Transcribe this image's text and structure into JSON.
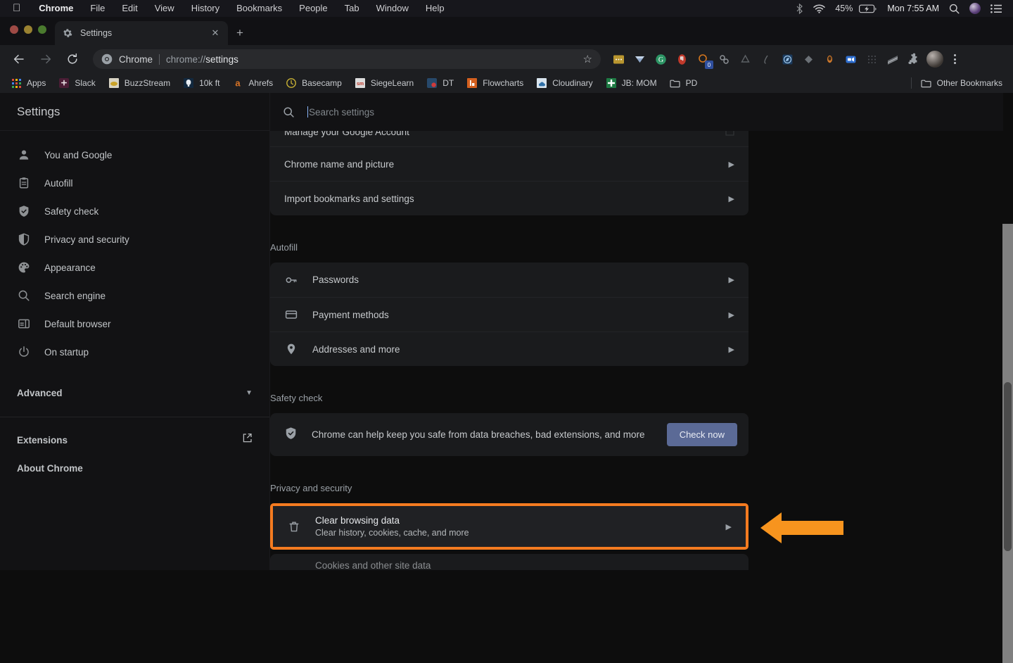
{
  "menubar": {
    "apple_icon": "apple-logo",
    "items": [
      {
        "label": "Chrome",
        "bold": true
      },
      {
        "label": "File",
        "bold": false
      },
      {
        "label": "Edit",
        "bold": false
      },
      {
        "label": "View",
        "bold": false
      },
      {
        "label": "History",
        "bold": false
      },
      {
        "label": "Bookmarks",
        "bold": false
      },
      {
        "label": "People",
        "bold": false
      },
      {
        "label": "Tab",
        "bold": false
      },
      {
        "label": "Window",
        "bold": false
      },
      {
        "label": "Help",
        "bold": false
      }
    ],
    "status": {
      "bluetooth_icon": "bluetooth-icon",
      "wifi_icon": "wifi-icon",
      "battery_percent": "45%",
      "battery_icon": "battery-charging-icon",
      "clock": "Mon 7:55 AM",
      "search_icon": "search-icon",
      "control_center_icon": "control-center-icon",
      "list_icon": "list-icon"
    }
  },
  "tabstrip": {
    "tab": {
      "title": "Settings",
      "favicon": "gear-icon",
      "close_icon": "close-icon"
    },
    "new_tab_label": "+"
  },
  "toolbar": {
    "back_icon": "back-arrow-icon",
    "forward_icon": "forward-arrow-icon",
    "reload_icon": "reload-icon",
    "omnibox": {
      "favicon": "chrome-icon",
      "label": "Chrome",
      "url_prefix": "chrome://",
      "url_bold": "settings",
      "bookmark_star_icon": "star-icon"
    },
    "extensions": [
      {
        "name": "extension-yellow-dots",
        "badge": ""
      },
      {
        "name": "extension-diamond",
        "badge": ""
      },
      {
        "name": "extension-grammarly",
        "badge": ""
      },
      {
        "name": "extension-opera-red",
        "badge": ""
      },
      {
        "name": "extension-orange-ring",
        "badge": "0"
      },
      {
        "name": "extension-link-chain",
        "badge": ""
      },
      {
        "name": "extension-recycle",
        "badge": ""
      },
      {
        "name": "extension-pen",
        "badge": ""
      },
      {
        "name": "extension-compass-blue",
        "badge": ""
      },
      {
        "name": "extension-diamond-gray",
        "badge": ""
      },
      {
        "name": "extension-person-orange",
        "badge": ""
      },
      {
        "name": "extension-video-blue",
        "badge": ""
      },
      {
        "name": "extension-grid-dots",
        "badge": ""
      },
      {
        "name": "extension-stripes",
        "badge": ""
      },
      {
        "name": "extension-puzzle",
        "badge": ""
      }
    ],
    "profile_avatar": "avatar",
    "menu_icon": "kebab-menu-icon"
  },
  "bookmarks_bar": {
    "items": [
      {
        "label": "Apps",
        "icon": "apps-grid-icon"
      },
      {
        "label": "Slack",
        "icon": "slack-icon"
      },
      {
        "label": "BuzzStream",
        "icon": "buzzstream-icon"
      },
      {
        "label": "10k ft",
        "icon": "balloon-icon"
      },
      {
        "label": "Ahrefs",
        "icon": "ahrefs-icon"
      },
      {
        "label": "Basecamp",
        "icon": "basecamp-icon"
      },
      {
        "label": "SiegeLearn",
        "icon": "siegelearn-icon"
      },
      {
        "label": "DT",
        "icon": "dt-icon"
      },
      {
        "label": "Flowcharts",
        "icon": "flowcharts-icon"
      },
      {
        "label": "Cloudinary",
        "icon": "cloudinary-icon"
      },
      {
        "label": "JB: MOM",
        "icon": "jb-mom-icon"
      },
      {
        "label": "PD",
        "icon": "folder-icon"
      }
    ],
    "other_bookmarks": {
      "label": "Other Bookmarks",
      "icon": "folder-icon"
    }
  },
  "sidebar": {
    "title": "Settings",
    "items": [
      {
        "label": "You and Google",
        "icon": "person-icon"
      },
      {
        "label": "Autofill",
        "icon": "clipboard-icon"
      },
      {
        "label": "Safety check",
        "icon": "shield-check-icon"
      },
      {
        "label": "Privacy and security",
        "icon": "shield-icon"
      },
      {
        "label": "Appearance",
        "icon": "palette-icon"
      },
      {
        "label": "Search engine",
        "icon": "search-icon"
      },
      {
        "label": "Default browser",
        "icon": "browser-window-icon"
      },
      {
        "label": "On startup",
        "icon": "power-icon"
      }
    ],
    "advanced": {
      "label": "Advanced",
      "icon": "chevron-down-icon"
    },
    "footer": [
      {
        "label": "Extensions",
        "icon": "external-link-icon"
      },
      {
        "label": "About Chrome",
        "icon": ""
      }
    ]
  },
  "search": {
    "placeholder": "Search settings",
    "icon": "search-icon",
    "value": ""
  },
  "content": {
    "partial_top_row": "Manage your Google Account",
    "account_card": [
      {
        "label": "Chrome name and picture",
        "icon": "",
        "arrow": "chevron-right-icon"
      },
      {
        "label": "Import bookmarks and settings",
        "icon": "",
        "arrow": "chevron-right-icon"
      }
    ],
    "autofill": {
      "heading": "Autofill",
      "rows": [
        {
          "label": "Passwords",
          "icon": "key-icon",
          "arrow": "chevron-right-icon"
        },
        {
          "label": "Payment methods",
          "icon": "credit-card-icon",
          "arrow": "chevron-right-icon"
        },
        {
          "label": "Addresses and more",
          "icon": "location-pin-icon",
          "arrow": "chevron-right-icon"
        }
      ]
    },
    "safety_check": {
      "heading": "Safety check",
      "icon": "shield-check-icon",
      "text": "Chrome can help keep you safe from data breaches, bad extensions, and more",
      "button_label": "Check now"
    },
    "privacy": {
      "heading": "Privacy and security",
      "highlighted_row": {
        "title": "Clear browsing data",
        "subtitle": "Clear history, cookies, cache, and more",
        "icon": "trash-icon",
        "arrow": "chevron-right-icon"
      },
      "next_row_partial": "Cookies and other site data"
    }
  },
  "annotation": {
    "arrow_icon": "left-arrow-annotation",
    "highlight_color": "#f47b20",
    "arrow_color": "#f7941e"
  },
  "scrollbar": {
    "track_color": "#808080",
    "thumb_color": "#4b4b4b"
  }
}
